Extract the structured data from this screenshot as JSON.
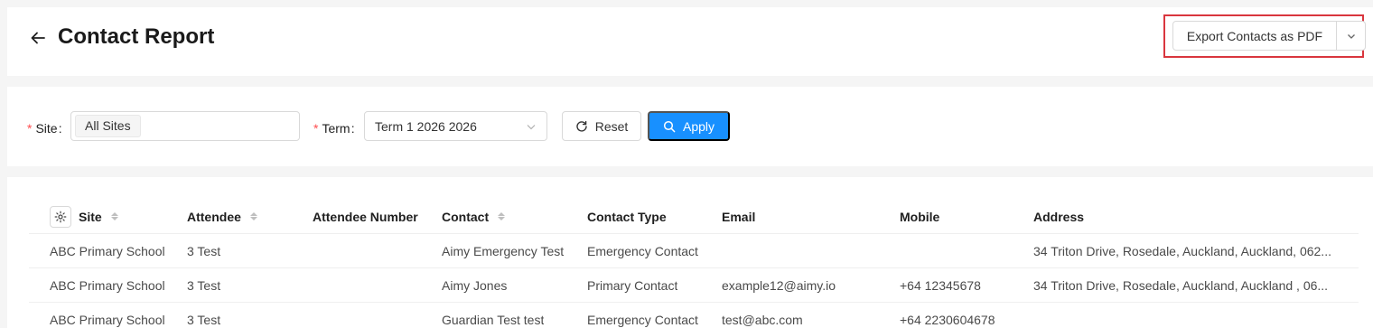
{
  "header": {
    "title": "Contact Report",
    "export_label": "Export Contacts as PDF"
  },
  "filters": {
    "site_label": "Site",
    "site_value": "All Sites",
    "term_label": "Term",
    "term_value": "Term 1 2026 2026",
    "reset_label": "Reset",
    "apply_label": "Apply",
    "required_marker": "*"
  },
  "table": {
    "columns": [
      "Site",
      "Attendee",
      "Attendee Number",
      "Contact",
      "Contact Type",
      "Email",
      "Mobile",
      "Address"
    ],
    "rows": [
      {
        "site": "ABC Primary School",
        "attendee": "3 Test",
        "attendee_number": "",
        "contact": "Aimy Emergency Test",
        "contact_type": "Emergency Contact",
        "email": "",
        "mobile": "",
        "address": "34 Triton Drive, Rosedale, Auckland, Auckland, 062..."
      },
      {
        "site": "ABC Primary School",
        "attendee": "3 Test",
        "attendee_number": "",
        "contact": "Aimy Jones",
        "contact_type": "Primary Contact",
        "email": "example12@aimy.io",
        "mobile": "+64 12345678",
        "address": "34 Triton Drive, Rosedale, Auckland, Auckland , 06..."
      },
      {
        "site": "ABC Primary School",
        "attendee": "3 Test",
        "attendee_number": "",
        "contact": "Guardian Test test",
        "contact_type": "Emergency Contact",
        "email": "test@abc.com",
        "mobile": "+64 2230604678",
        "address": ""
      }
    ]
  },
  "colors": {
    "primary": "#1890ff",
    "highlight": "#d9363e",
    "required": "#ff4d4f"
  }
}
